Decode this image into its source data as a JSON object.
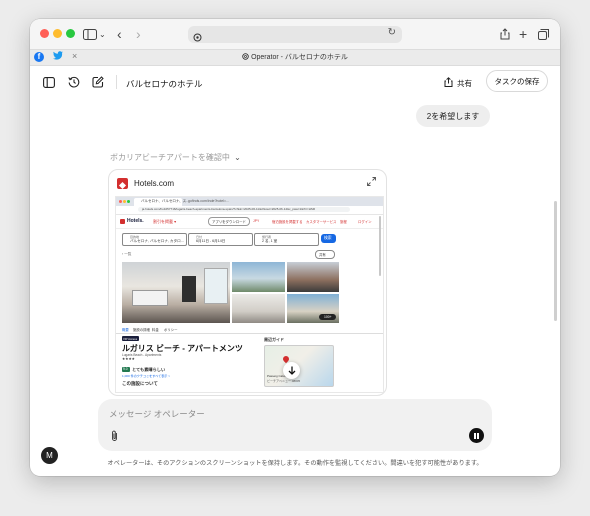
{
  "browser": {
    "tab_title": "Operator - バルセロナのホテル",
    "close_tab_glyph": "×"
  },
  "header": {
    "conversation_title": "バルセロナのホテル",
    "share_label": "共有",
    "save_task_label": "タスクの保存"
  },
  "chat": {
    "user_message": "2を希望します",
    "status_text": "ボカリアビーチアパートを確認中"
  },
  "card": {
    "title": "Hotels.com",
    "screenshot": {
      "tab1": "バルセロナ、バルセロナ、ス…",
      "tab2": "gofinds.com/inde?hotel=…",
      "url": "ja.hotels.com/ho1057716/lugaris-beach-apartments-barcelona-spain/?chkin=2025-06-11&chkout=2025-06-14&x_pwa=1&rfrr=HSR",
      "brand": "Hotels.",
      "nav_deals": "割引を掲載 ▾",
      "app_btn": "アプリをダウンロード",
      "nav_jpy": "JPY",
      "nav_list": "宿泊施設を掲載する",
      "nav_support": "カスタマーサービス",
      "nav_trips": "旅程",
      "nav_login": "ログイン",
      "dest_label": "目的地",
      "dest_value": "バルセロナ, バルセロナ, カタロ…",
      "dates_label": "日付",
      "dates_value": "6月11日 - 6月14日",
      "guests_label": "旅行者",
      "guests_value": "2 名, 1 室",
      "search_btn": "検索",
      "back_link": "‹ 一覧",
      "map_link": "共有",
      "photo_count": "100+",
      "subnav": [
        "概要",
        "施設の詳細",
        "料金",
        "ポリシー"
      ],
      "badge": "VIP Access",
      "hotel_name": "ルガリス ビーチ - アパートメンツ",
      "hotel_sub": "Lugaris Beach - Apartments",
      "stars": "★★★★",
      "rating": "9.0",
      "rating_text": "とても素晴らしい",
      "reviews_link": "1,000 件のクチコミをすべて表示 >",
      "about": "この施設について",
      "area_guide": "周辺ガイド",
      "map_caption": "Passeig Calvell",
      "map_caption2": "ビーチアベニュー 08005"
    }
  },
  "input": {
    "placeholder": "メッセージ オペレーター"
  },
  "avatar_letter": "M",
  "disclaimer": "オペレーターは、そのアクションのスクリーンショットを保持します。その動作を監視してください。間違いを犯す可能性があります。",
  "colors": {
    "hotels_red": "#d32f2f",
    "search_blue": "#1668e3",
    "rating_green": "#227950"
  }
}
